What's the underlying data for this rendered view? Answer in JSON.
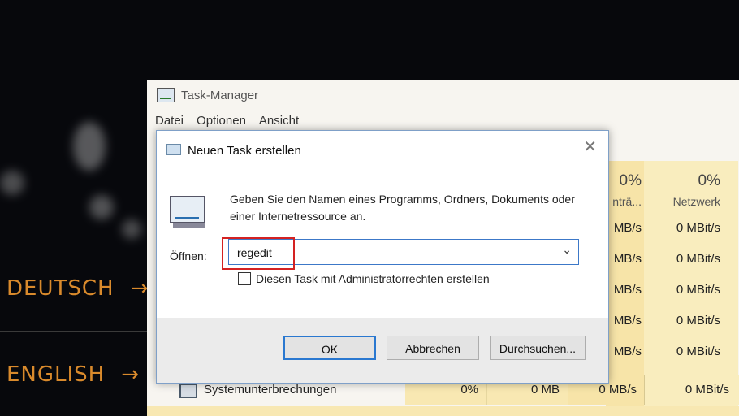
{
  "background": {
    "languages": [
      {
        "label": "DEUTSCH",
        "arrow": "→"
      },
      {
        "label": "ENGLISH",
        "arrow": "→"
      }
    ],
    "accent_color": "#d98a2c"
  },
  "task_manager": {
    "title": "Task-Manager",
    "menu": [
      "Datei",
      "Optionen",
      "Ansicht"
    ],
    "columns": {
      "disk": {
        "percent": "0%",
        "header": "nträ..."
      },
      "network": {
        "percent": "0%",
        "header": "Netzwerk"
      }
    },
    "disk_cells": [
      "MB/s",
      "MB/s",
      "MB/s",
      "MB/s",
      "MB/s",
      "MB/s"
    ],
    "network_cells": [
      "0 MBit/s",
      "0 MBit/s",
      "0 MBit/s",
      "0 MBit/s",
      "0 MBit/s",
      "0 MBit/s"
    ],
    "last_row": {
      "name": "Systemunterbrechungen",
      "cpu": "0%",
      "memory": "0 MB",
      "disk": "0 MB/s",
      "network": "0 MBit/s"
    }
  },
  "dialog": {
    "title": "Neuen Task erstellen",
    "close_glyph": "✕",
    "description": "Geben Sie den Namen eines Programms, Ordners, Dokuments oder einer Internetressource an.",
    "open_label": "Öffnen:",
    "input_value": "regedit",
    "dropdown_glyph": "⌄",
    "admin_checkbox_label": "Diesen Task mit Administratorrechten erstellen",
    "admin_checked": false,
    "buttons": {
      "ok": "OK",
      "cancel": "Abbrechen",
      "browse": "Durchsuchen..."
    }
  }
}
